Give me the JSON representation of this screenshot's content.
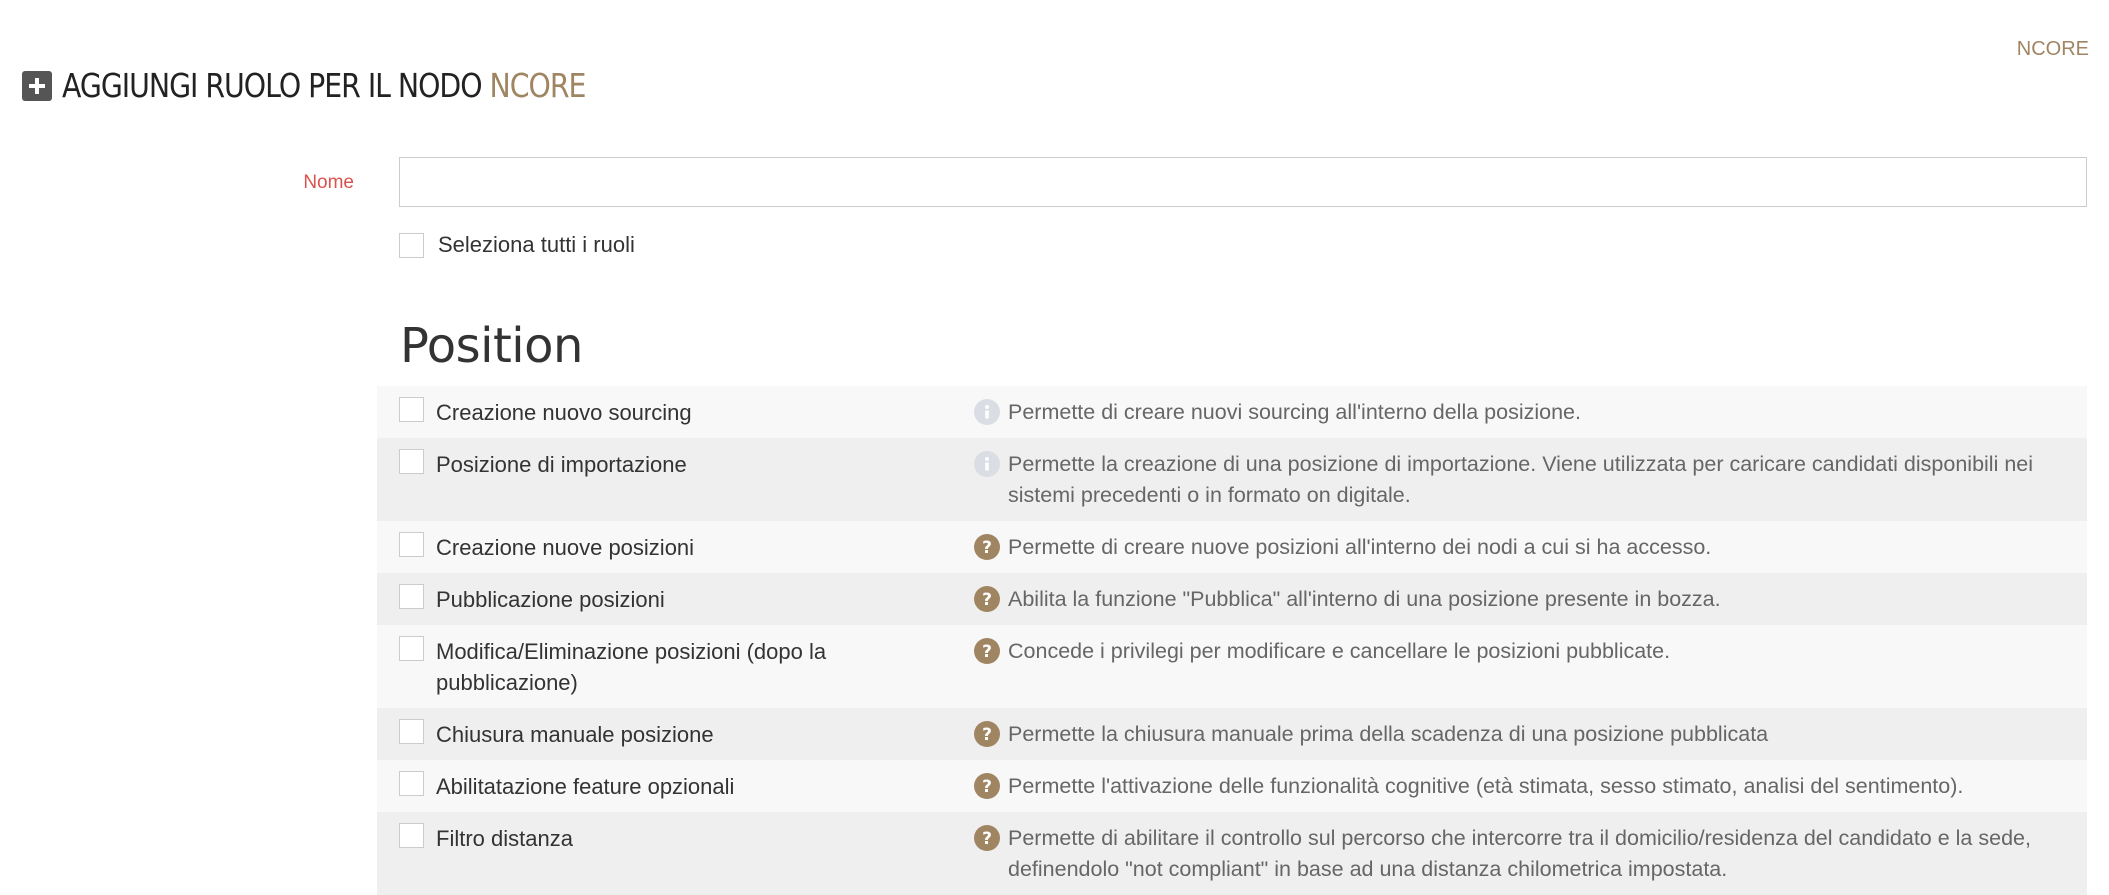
{
  "header": {
    "node_link": "NCORE",
    "title_prefix": "AGGIUNGI RUOLO PER IL NODO ",
    "title_node": "NCORE"
  },
  "form": {
    "name_label": "Nome",
    "name_value": "",
    "select_all_label": "Seleziona tutti i ruoli"
  },
  "section": {
    "title": "Position",
    "permissions": [
      {
        "label": "Creazione nuovo sourcing",
        "icon": "info-icon",
        "description": "Permette di creare nuovi sourcing all'interno della posizione."
      },
      {
        "label": "Posizione di importazione",
        "icon": "info-icon",
        "description": "Permette la creazione di una posizione di importazione. Viene utilizzata per caricare candidati disponibili nei sistemi precedenti o in formato on digitale."
      },
      {
        "label": "Creazione nuove posizioni",
        "icon": "question-icon",
        "description": "Permette di creare nuove posizioni all'interno dei nodi a cui si ha accesso."
      },
      {
        "label": "Pubblicazione posizioni",
        "icon": "question-icon",
        "description": "Abilita la funzione \"Pubblica\" all'interno di una posizione presente in bozza."
      },
      {
        "label": "Modifica/Eliminazione posizioni (dopo la pubblicazione)",
        "icon": "question-icon",
        "description": "Concede i privilegi per modificare e cancellare le posizioni pubblicate."
      },
      {
        "label": "Chiusura manuale posizione",
        "icon": "question-icon",
        "description": "Permette la chiusura manuale prima della scadenza di una posizione pubblicata"
      },
      {
        "label": "Abilitatazione feature opzionali",
        "icon": "question-icon",
        "description": "Permette l'attivazione delle funzionalità cognitive (età stimata, sesso stimato, analisi del sentimento)."
      },
      {
        "label": "Filtro distanza",
        "icon": "question-icon",
        "description": "Permette di abilitare il controllo sul percorso che intercorre tra il domicilio/residenza del candidato e la sede, definendolo \"not compliant\" in base ad una distanza chilometrica impostata."
      }
    ]
  },
  "colors": {
    "accent": "#a08562",
    "required_label": "#d9534f",
    "info_icon": "#dadde3"
  }
}
